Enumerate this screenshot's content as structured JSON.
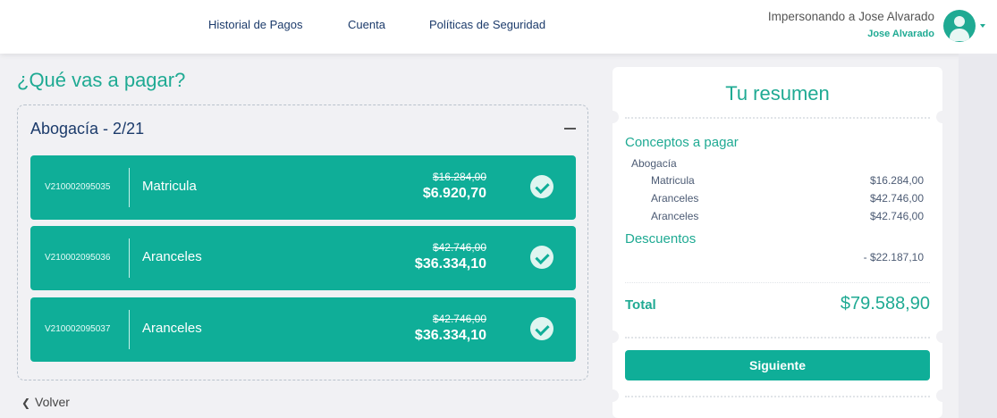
{
  "header": {
    "nav": [
      "Historial de Pagos",
      "Cuenta",
      "Políticas de Seguridad"
    ],
    "impersonating_text": "Impersonando a Jose Alvarado",
    "user_name": "Jose Alvarado"
  },
  "main": {
    "title": "¿Qué vas a pagar?",
    "group_title": "Abogacía - 2/21",
    "items": [
      {
        "code": "V210002095035",
        "concept": "Matricula",
        "old_price": "$16.284,00",
        "new_price": "$6.920,70",
        "selected": true
      },
      {
        "code": "V210002095036",
        "concept": "Aranceles",
        "old_price": "$42.746,00",
        "new_price": "$36.334,10",
        "selected": true
      },
      {
        "code": "V210002095037",
        "concept": "Aranceles",
        "old_price": "$42.746,00",
        "new_price": "$36.334,10",
        "selected": true
      }
    ],
    "back_label": "Volver"
  },
  "summary": {
    "title": "Tu resumen",
    "concepts_title": "Conceptos a pagar",
    "category": "Abogacía",
    "lines": [
      {
        "label": "Matricula",
        "value": "$16.284,00"
      },
      {
        "label": "Aranceles",
        "value": "$42.746,00"
      },
      {
        "label": "Aranceles",
        "value": "$42.746,00"
      }
    ],
    "discounts_title": "Descuentos",
    "discount_value": "- $22.187,10",
    "total_label": "Total",
    "total_value": "$79.588,90",
    "next_button": "Siguiente"
  },
  "colors": {
    "accent": "#1faa93",
    "item_bg": "#0fae98",
    "nav_text": "#1c3b6b",
    "page_bg": "#f1f1f4"
  }
}
